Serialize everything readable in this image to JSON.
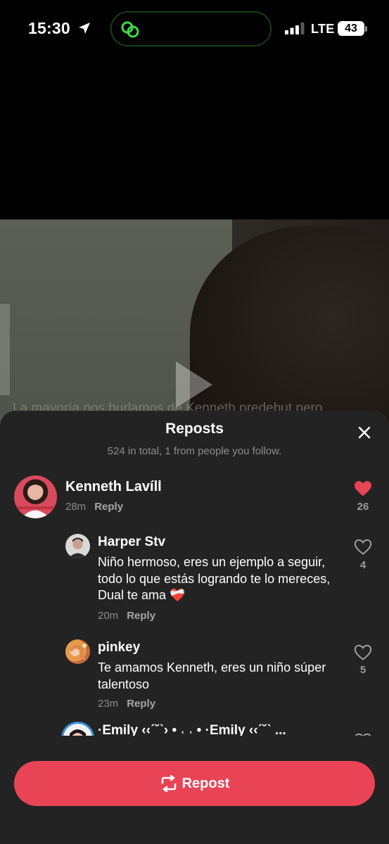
{
  "status_bar": {
    "time": "15:30",
    "network": "LTE",
    "battery": "43"
  },
  "video": {
    "caption": "La mayoría nos burlamos de Kenneth predebut pero"
  },
  "sheet": {
    "title": "Reposts",
    "subtitle": "524 in total, 1 from people you follow.",
    "reply_label": "Reply"
  },
  "comments": [
    {
      "name": "Kenneth Lavíll",
      "text": "",
      "time": "28m",
      "likes": "26",
      "liked": true
    },
    {
      "name": "Harper Stv",
      "text": "Niño hermoso, eres un ejemplo a seguir, todo lo que estás logrando te lo mereces, Dual te ama ❤️‍🩹",
      "time": "20m",
      "likes": "4",
      "liked": false
    },
    {
      "name": "pinkey",
      "text": "Te amamos Kenneth, eres un niño súper talentoso",
      "time": "23m",
      "likes": "5",
      "liked": false
    },
    {
      "name": "·Emily ‹‹ˊ˘ˋ› • ˓ ˒ • ·Emily ‹‹ˊ˘ˋ ...",
      "text": "",
      "time": "",
      "likes": "",
      "liked": false
    }
  ],
  "repost_button": {
    "label": "Repost"
  },
  "colors": {
    "accent": "#e94456",
    "sheet_bg": "#232323",
    "muted_text": "#8c8c8c",
    "heart_active": "#e94456"
  }
}
